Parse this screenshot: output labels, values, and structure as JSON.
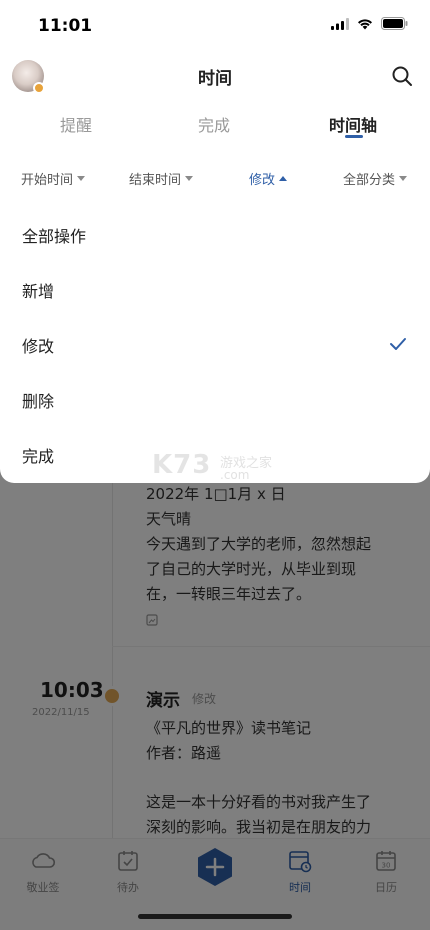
{
  "status_bar": {
    "time": "11:01"
  },
  "header": {
    "title": "时间"
  },
  "tabs": [
    {
      "label": "提醒"
    },
    {
      "label": "完成"
    },
    {
      "label": "时间轴"
    }
  ],
  "filters": [
    {
      "label": "开始时间"
    },
    {
      "label": "结束时间"
    },
    {
      "label": "修改"
    },
    {
      "label": "全部分类"
    }
  ],
  "dropdown": {
    "options": [
      {
        "label": "全部操作"
      },
      {
        "label": "新增"
      },
      {
        "label": "修改"
      },
      {
        "label": "删除"
      },
      {
        "label": "完成"
      }
    ],
    "selected": "修改"
  },
  "timeline": {
    "entry1": {
      "lines": [
        "2022年 1□1月 x 日",
        "天气晴",
        "今天遇到了大学的老师，忽然想起",
        "了自己的大学时光，从毕业到现",
        "在，一转眼三年过去了。"
      ]
    },
    "entry2": {
      "time": "10:03",
      "date": "2022/11/15",
      "title": "演示",
      "tag": "修改",
      "lines": [
        "《平凡的世界》读书笔记",
        "作者：路遥",
        "",
        "这是一本十分好看的书对我产生了",
        "深刻的影响。我当初是在朋友的力"
      ]
    }
  },
  "bottom_nav": [
    {
      "label": "敬业签"
    },
    {
      "label": "待办"
    },
    {
      "label": ""
    },
    {
      "label": "时间"
    },
    {
      "label": "日历"
    }
  ],
  "watermark": {
    "main": "K73",
    "cn": "游戏之家",
    "com": ".com"
  },
  "colors": {
    "accent": "#2f5fa7",
    "badge": "#e3a955"
  }
}
